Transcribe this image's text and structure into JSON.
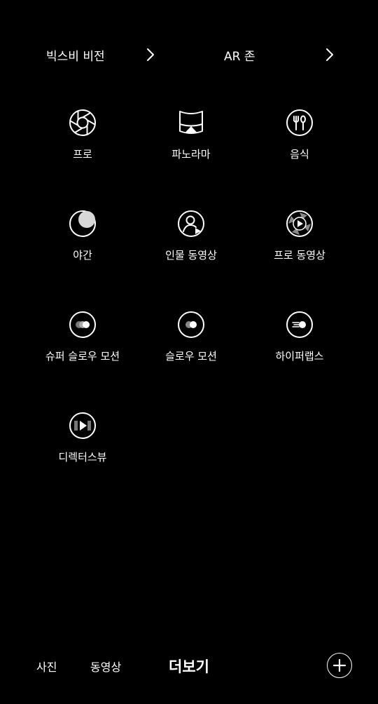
{
  "top_links": [
    {
      "label": "빅스비 비전",
      "icon": "chevron-right-icon"
    },
    {
      "label": "AR 존",
      "icon": "chevron-right-icon"
    }
  ],
  "modes": [
    {
      "label": "프로",
      "icon": "aperture-icon"
    },
    {
      "label": "파노라마",
      "icon": "panorama-icon"
    },
    {
      "label": "음식",
      "icon": "food-icon"
    },
    {
      "label": "야간",
      "icon": "moon-icon"
    },
    {
      "label": "인물 동영상",
      "icon": "portrait-video-icon"
    },
    {
      "label": "프로 동영상",
      "icon": "pro-video-icon"
    },
    {
      "label": "슈퍼 슬로우 모션",
      "icon": "super-slow-motion-icon"
    },
    {
      "label": "슬로우 모션",
      "icon": "slow-motion-icon"
    },
    {
      "label": "하이퍼랩스",
      "icon": "hyperlapse-icon"
    },
    {
      "label": "디렉터스뷰",
      "icon": "directors-view-icon"
    }
  ],
  "bottom_tabs": [
    {
      "label": "사진",
      "selected": false
    },
    {
      "label": "동영상",
      "selected": false
    },
    {
      "label": "더보기",
      "selected": true
    }
  ],
  "add_button_icon": "plus-icon",
  "colors": {
    "background": "#000000",
    "foreground": "#ffffff"
  }
}
